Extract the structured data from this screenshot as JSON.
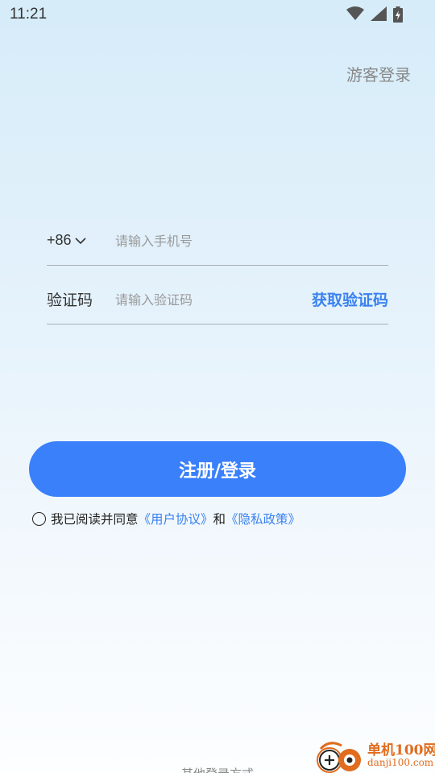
{
  "status_bar": {
    "time": "11:21",
    "icons": [
      "wifi-icon",
      "signal-icon",
      "battery-charging-icon"
    ]
  },
  "header": {
    "guest_login_label": "游客登录"
  },
  "form": {
    "phone": {
      "country_code": "+86",
      "placeholder": "请输入手机号",
      "value": ""
    },
    "verification": {
      "label": "验证码",
      "placeholder": "请输入验证码",
      "value": "",
      "get_code_label": "获取验证码"
    },
    "submit_label": "注册/登录"
  },
  "agreement": {
    "prefix": "我已阅读并同意",
    "user_agreement": "《用户协议》",
    "conjunction": "和",
    "privacy_policy": "《隐私政策》",
    "checked": false
  },
  "footer": {
    "other_login_hint": "其他登录方式"
  },
  "watermark": {
    "title": "单机100网",
    "url": "danji100.com"
  },
  "colors": {
    "accent": "#3a80fb",
    "link": "#3a82f0",
    "watermark": "#e06c1e"
  }
}
